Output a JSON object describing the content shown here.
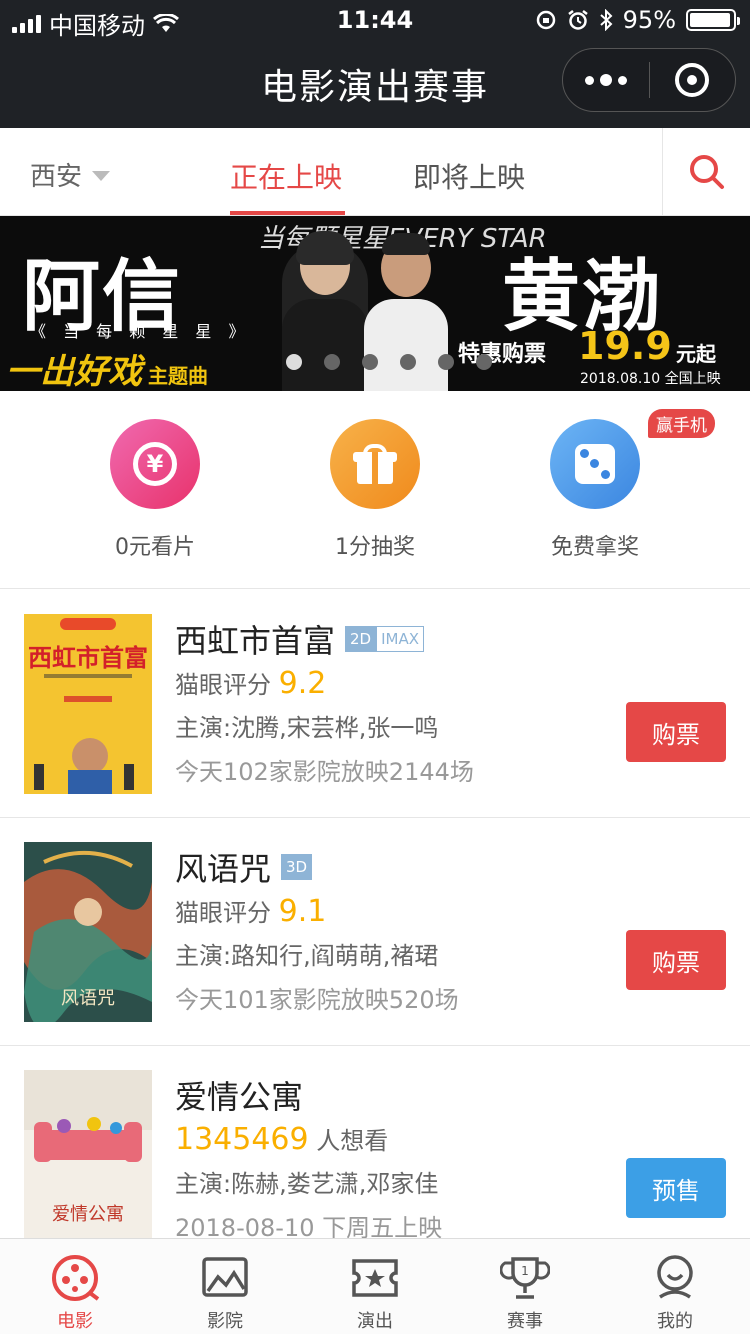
{
  "status": {
    "carrier": "中国移动",
    "time": "11:44",
    "battery": "95%",
    "battery_level": 0.95
  },
  "nav": {
    "title": "电影演出赛事"
  },
  "tabs": {
    "city": "西安",
    "now_showing": "正在上映",
    "coming_soon": "即将上映"
  },
  "banner": {
    "left_name": "阿信",
    "right_name": "黄渤",
    "left_sub": "《 当 每 颗 星 星 》",
    "script": "一出好戏",
    "script_tag": "主题曲",
    "arc_text": "当每颗星星EVERY STAR",
    "promo": "特惠购票",
    "price": "19.9",
    "price_unit": "元起",
    "date": "2018.08.10 全国上映"
  },
  "features": [
    {
      "label": "0元看片",
      "icon": "yen-slash-icon",
      "color": "#e8326b"
    },
    {
      "label": "1分抽奖",
      "icon": "gift-icon",
      "color": "#f08a1c"
    },
    {
      "label": "免费拿奖",
      "icon": "dice-icon",
      "color": "#3b86e0",
      "badge": "赢手机"
    }
  ],
  "movies": [
    {
      "title": "西虹市首富",
      "tags": [
        "2D",
        "IMAX"
      ],
      "score_label": "猫眼评分",
      "score": "9.2",
      "cast": "主演:沈腾,宋芸桦,张一鸣",
      "showing": "今天102家影院放映2144场",
      "button": "购票"
    },
    {
      "title": "风语咒",
      "tags": [
        "3D"
      ],
      "score_label": "猫眼评分",
      "score": "9.1",
      "cast": "主演:路知行,阎萌萌,褚珺",
      "showing": "今天101家影院放映520场",
      "button": "购票"
    },
    {
      "title": "爱情公寓",
      "want_count": "1345469",
      "want_label": "人想看",
      "cast": "主演:陈赫,娄艺潇,邓家佳",
      "release": "2018-08-10 下周五上映",
      "button": "预售"
    }
  ],
  "bottom_nav": [
    {
      "label": "电影",
      "icon": "film-reel-icon",
      "active": true
    },
    {
      "label": "影院",
      "icon": "cinema-icon"
    },
    {
      "label": "演出",
      "icon": "ticket-icon"
    },
    {
      "label": "赛事",
      "icon": "trophy-icon"
    },
    {
      "label": "我的",
      "icon": "user-icon"
    }
  ],
  "colors": {
    "accent": "#e54847",
    "score": "#faaf00",
    "presale": "#3c9fe6",
    "topbar": "#1f2226"
  }
}
